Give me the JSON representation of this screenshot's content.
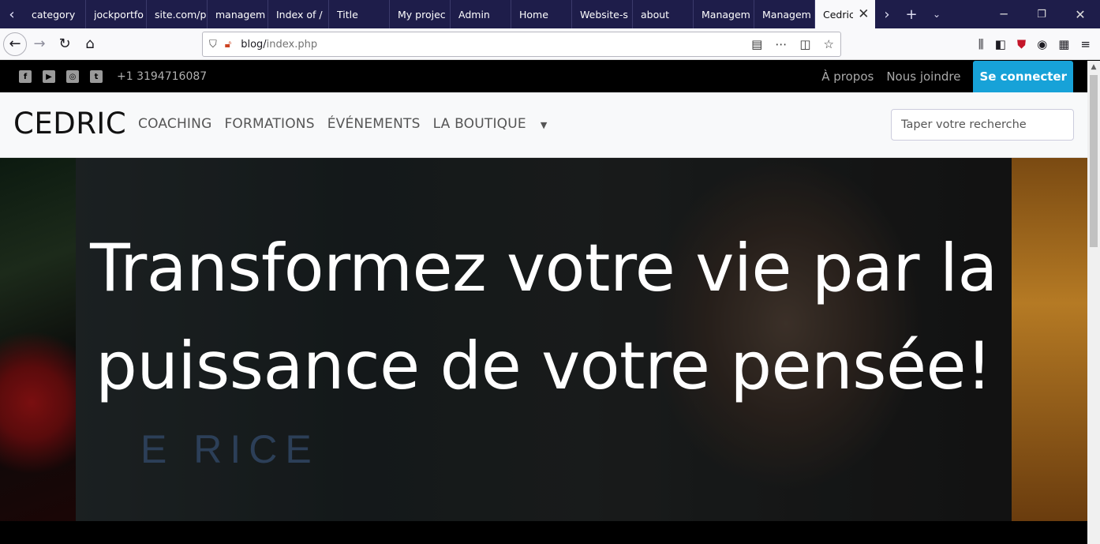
{
  "browser": {
    "tabs": [
      {
        "label": "category"
      },
      {
        "label": "jockportfo"
      },
      {
        "label": "site.com/p"
      },
      {
        "label": "managem"
      },
      {
        "label": "Index of /"
      },
      {
        "label": "Title"
      },
      {
        "label": "My projec"
      },
      {
        "label": "Admin"
      },
      {
        "label": "Home"
      },
      {
        "label": "Website-s"
      },
      {
        "label": "about"
      },
      {
        "label": "Managem"
      },
      {
        "label": "Managem"
      },
      {
        "label": "Cedric"
      }
    ],
    "url_host": "blog/",
    "url_path": "index.php"
  },
  "site": {
    "topbar": {
      "phone": "+1 3194716087",
      "links": {
        "about": "À propos",
        "contact": "Nous joindre"
      },
      "login": "Se connecter",
      "social_icons": [
        "facebook-icon",
        "youtube-icon",
        "instagram-icon",
        "twitter-icon"
      ]
    },
    "nav": {
      "brand": "CEDRIC",
      "menu": {
        "coaching": "COACHING",
        "formations": "FORMATIONS",
        "evenements": "ÉVÉNEMENTS",
        "boutique": "LA BOUTIQUE"
      },
      "search_placeholder": "Taper votre recherche"
    },
    "hero": {
      "headline": "Transformez votre vie par la puissance de votre pensée!",
      "watermark": "E RICE"
    }
  },
  "colors": {
    "tabstrip": "#1e1d4a",
    "login_button": "#17a2d8",
    "topbar": "#000000"
  }
}
